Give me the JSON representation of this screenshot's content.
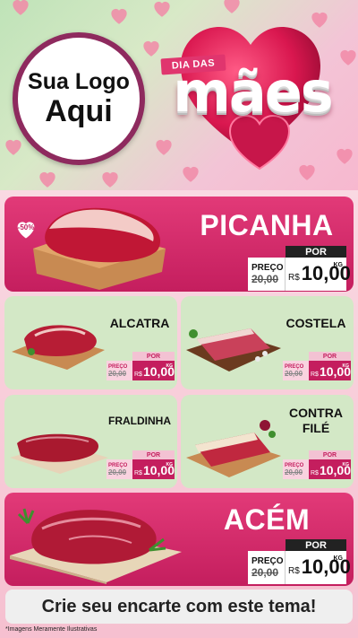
{
  "header": {
    "logo_line1": "Sua Logo",
    "logo_line2": "Aqui",
    "badge_small": "DIA DAS",
    "badge_big": "mães"
  },
  "colors": {
    "pink": "#c41e5e",
    "green_card": "#d3e8c6",
    "logo_border": "#8e2a5e"
  },
  "products": {
    "picanha": {
      "name": "PICANHA",
      "discount": "-50%",
      "por": "POR",
      "preco_label": "PREÇO",
      "old_price": "20,00",
      "currency": "R$",
      "price": "10,00",
      "unit": "KG"
    },
    "alcatra": {
      "name": "ALCATRA",
      "por": "POR",
      "preco_label": "PREÇO",
      "old_price": "20,00",
      "currency": "R$",
      "price": "10,00",
      "unit": "KG"
    },
    "costela": {
      "name": "COSTELA",
      "por": "POR",
      "preco_label": "PREÇO",
      "old_price": "20,00",
      "currency": "R$",
      "price": "10,00",
      "unit": "KG"
    },
    "fraldinha": {
      "name": "FRALDINHA",
      "por": "POR",
      "preco_label": "PREÇO",
      "old_price": "20,00",
      "currency": "R$",
      "price": "10,00",
      "unit": "KG"
    },
    "contrafile": {
      "name_line1": "CONTRA",
      "name_line2": "FILÉ",
      "por": "POR",
      "preco_label": "PREÇO",
      "old_price": "20,00",
      "currency": "R$",
      "price": "10,00",
      "unit": "KG"
    },
    "acem": {
      "name": "ACÉM",
      "por": "POR",
      "preco_label": "PREÇO",
      "old_price": "20,00",
      "currency": "R$",
      "price": "10,00",
      "unit": "KG"
    }
  },
  "footer": {
    "cta": "Crie seu encarte com este tema!",
    "disclaimer": "*Imagens Meramente Ilustrativas"
  }
}
